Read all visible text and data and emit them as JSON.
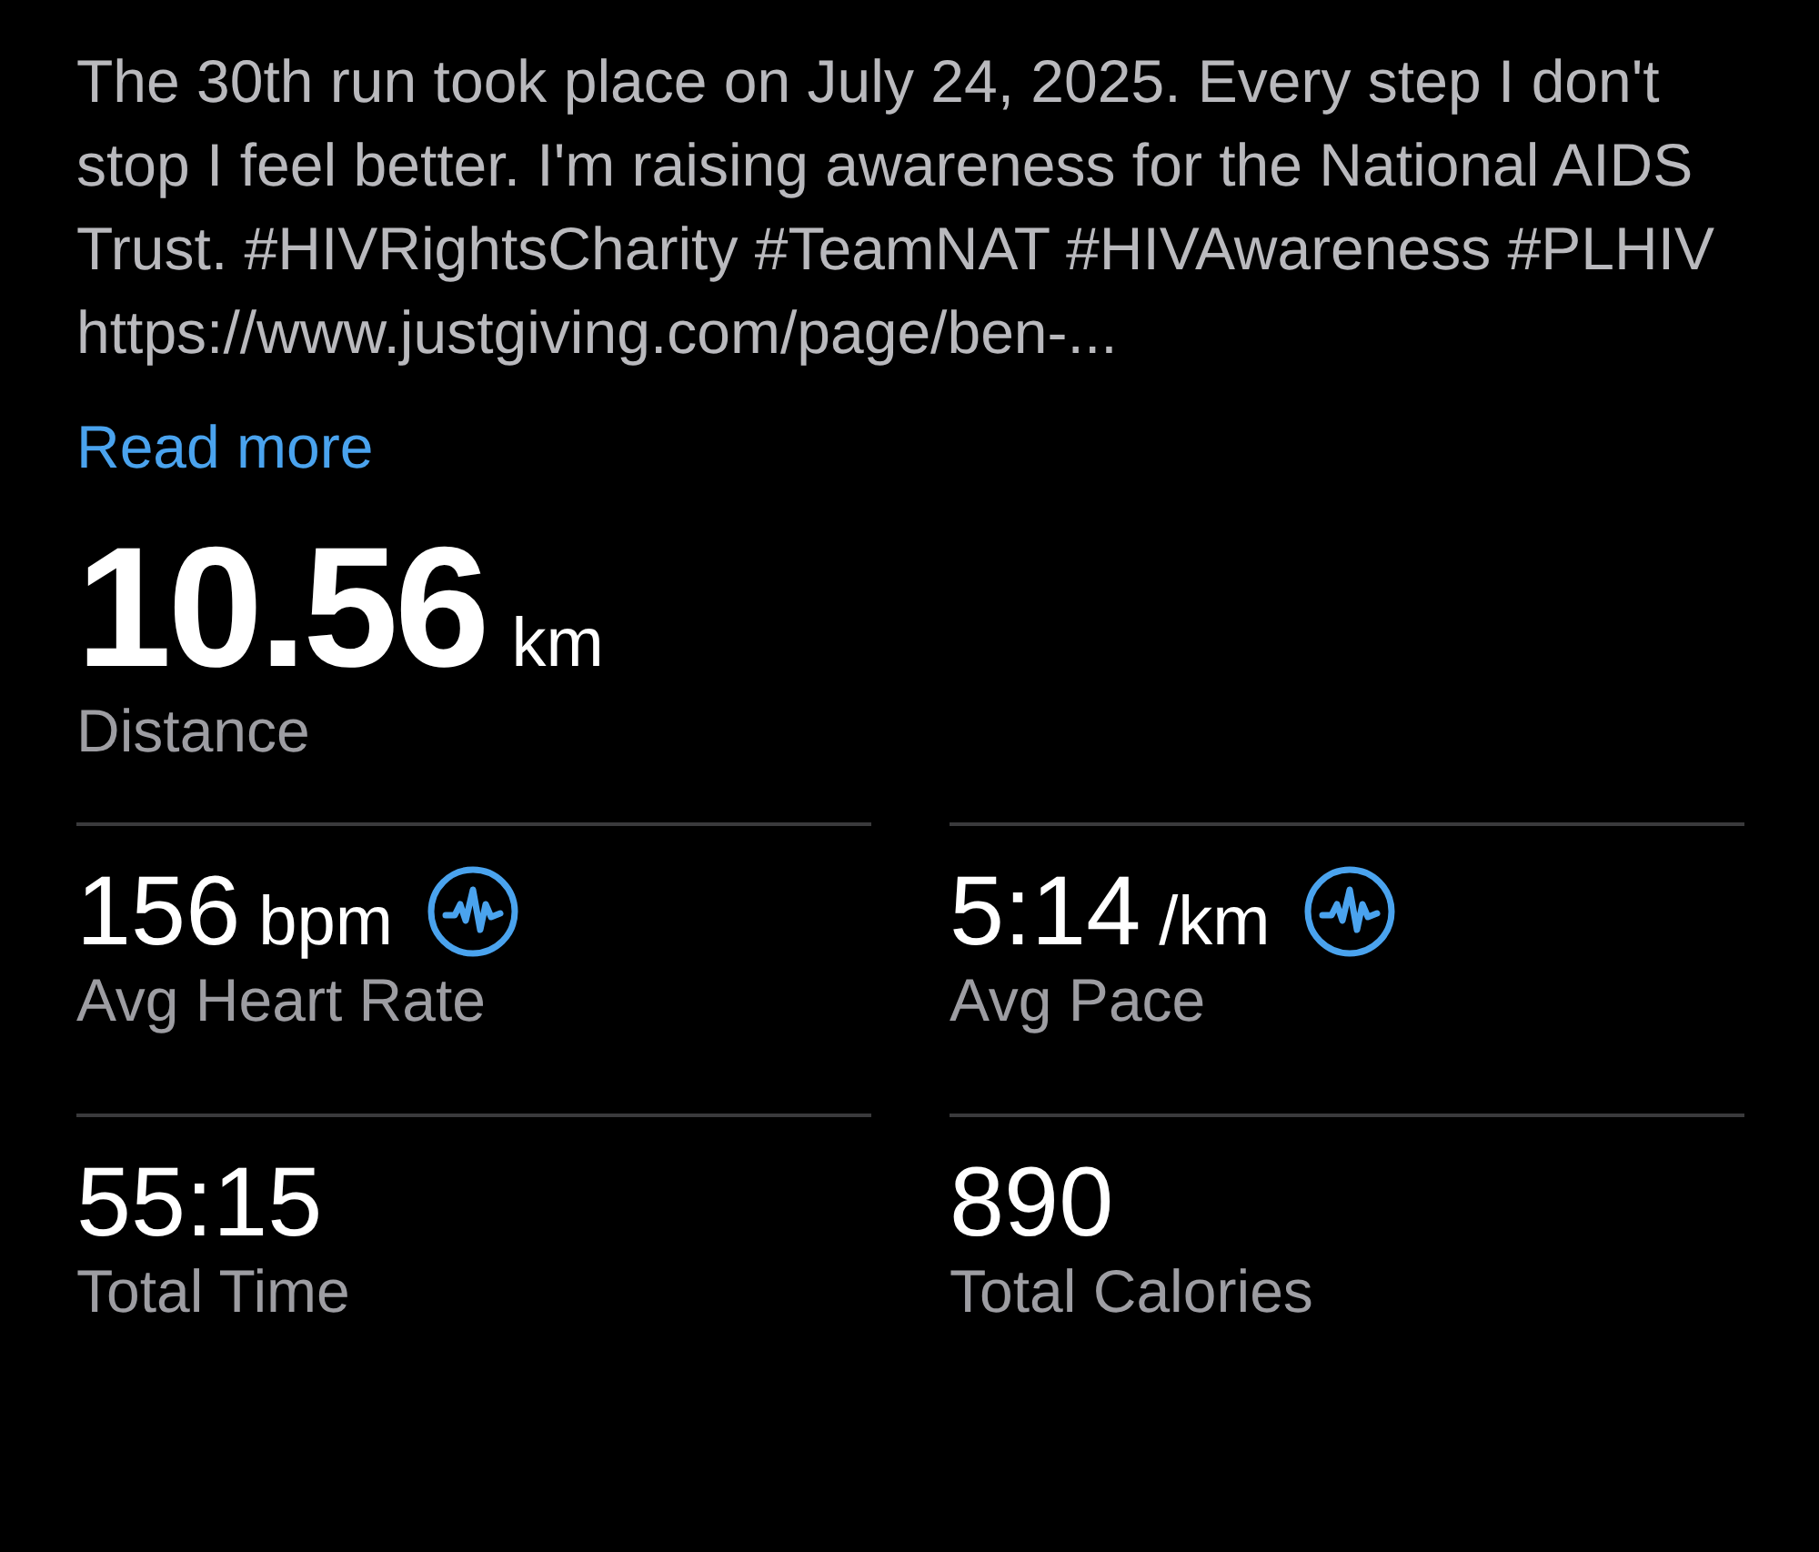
{
  "description": "The 30th run took place on July 24, 2025. Every step I don't stop I feel better. I'm raising awareness for the National AIDS Trust. #HIVRightsCharity #TeamNAT #HIVAwareness #PLHIV https://www.justgiving.com/page/ben-...",
  "read_more": "Read more",
  "distance": {
    "value": "10.56",
    "unit": "km",
    "label": "Distance"
  },
  "stats": [
    {
      "value": "156",
      "unit": "bpm",
      "label": "Avg Heart Rate",
      "has_chart_icon": true
    },
    {
      "value": "5:14",
      "unit": "/km",
      "label": "Avg Pace",
      "has_chart_icon": true
    },
    {
      "value": "55:15",
      "label": "Total Time",
      "has_chart_icon": false
    },
    {
      "value": "890",
      "label": "Total Calories",
      "has_chart_icon": false
    }
  ]
}
